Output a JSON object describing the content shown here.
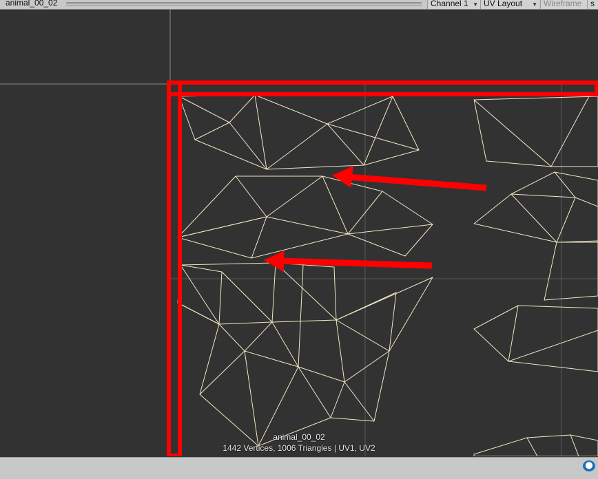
{
  "header": {
    "title": "animal_00_02",
    "channel": "Channel 1",
    "layout_mode": "UV Layout",
    "wireframe": "Wireframe",
    "extra": "s"
  },
  "overlay": {
    "mesh_name": "animal_00_02",
    "stats": "1442 Vertices, 1006 Triangles | UV1, UV2"
  },
  "colors": {
    "background": "#323232",
    "wire": "#f2e8c4",
    "grid": "#8c8c8c",
    "annotation": "#ff0000",
    "toolbar": "#c8c8c8"
  },
  "icons": {
    "status": "tag-icon"
  }
}
